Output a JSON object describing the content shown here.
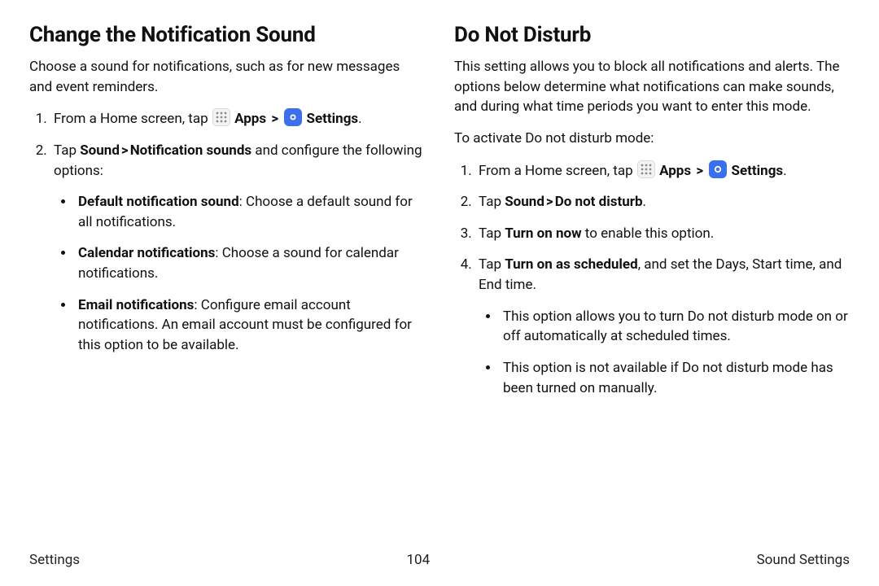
{
  "left": {
    "heading": "Change the Notification Sound",
    "intro": "Choose a sound for notifications, such as for new messages and event reminders.",
    "step1_pre": "From a Home screen, tap ",
    "apps_label": "Apps",
    "settings_label": "Settings",
    "period": ".",
    "step2_a": "Tap ",
    "step2_b": "Sound",
    "step2_c": "Notification sounds",
    "step2_d": " and configure the following options:",
    "bullets": {
      "b1_bold": "Default notification sound",
      "b1_rest": ": Choose a default sound for all notifications.",
      "b2_bold": "Calendar notifications",
      "b2_rest": ": Choose a sound for calendar notifications.",
      "b3_bold": "Email notifications",
      "b3_rest": ": Configure email account notifications. An email account must be configured for this option to be available."
    }
  },
  "right": {
    "heading": "Do Not Disturb",
    "intro": "This setting allows you to block all notifications and alerts. The options below determine what notifications can make sounds, and during what time periods you want to enter this mode.",
    "activate": "To activate Do not disturb mode:",
    "step1_pre": "From a Home screen, tap ",
    "apps_label": "Apps",
    "settings_label": "Settings",
    "period": ".",
    "step2_a": "Tap ",
    "step2_b": "Sound",
    "step2_c": "Do not disturb",
    "step2_d": ".",
    "step3_a": "Tap ",
    "step3_b": "Turn on now",
    "step3_c": " to enable this option.",
    "step4_a": "Tap ",
    "step4_b": "Turn on as scheduled",
    "step4_c": ", and set the Days, Start time, and End time.",
    "bullets": {
      "b1": "This option allows you to turn Do not disturb mode on or off automatically at scheduled times.",
      "b2": "This option is not available if Do not disturb mode has been turned on manually."
    }
  },
  "footer": {
    "left": "Settings",
    "center": "104",
    "right": "Sound Settings"
  },
  "chevron": ">"
}
